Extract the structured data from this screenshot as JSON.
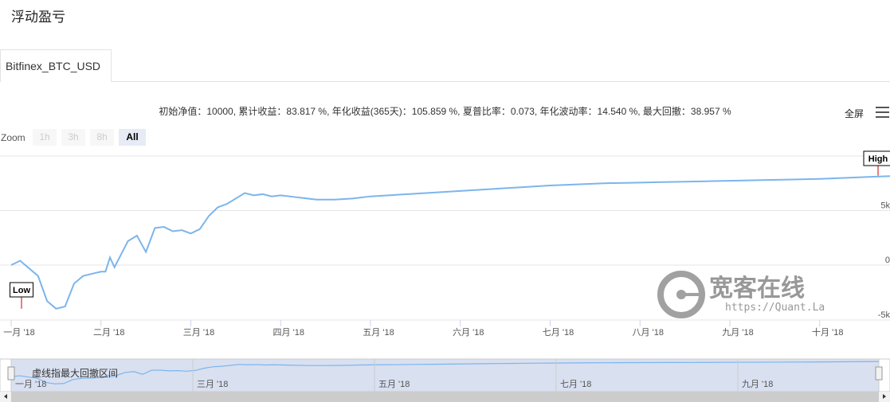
{
  "page": {
    "title": "浮动盈亏",
    "tab": "Bitfinex_BTC_USD",
    "stats": "初始净值：10000, 累计收益：83.817 %, 年化收益(365天)：105.859 %, 夏普比率：0.073, 年化波动率：14.540 %, 最大回撤：38.957 %",
    "fullscreen_label": "全屏",
    "zoom_label": "Zoom",
    "zoom_buttons": [
      "1h",
      "3h",
      "8h",
      "All"
    ],
    "zoom_active": "All",
    "navigator_note": "虚线指最大回撤区间",
    "watermark_name": "宽客在线",
    "watermark_url": "https://Quant.La"
  },
  "chart_data": {
    "type": "line",
    "x_ticks": [
      "一月 '18",
      "二月 '18",
      "三月 '18",
      "四月 '18",
      "五月 '18",
      "六月 '18",
      "七月 '18",
      "八月 '18",
      "九月 '18",
      "十月 '18"
    ],
    "y_ticks": [
      "-5k",
      "0",
      "5k"
    ],
    "y_range": [
      -5000,
      10000
    ],
    "flags": [
      {
        "label": "High",
        "x": 1.0
      },
      {
        "label": "Low",
        "x": 0.145
      }
    ],
    "navigator_ticks": [
      "一月 '18",
      "三月 '18",
      "五月 '18",
      "七月 '18",
      "九月 '18"
    ],
    "series": [
      {
        "color": "#7cb5ec",
        "x": [
          0,
          0.1,
          0.2,
          0.3,
          0.4,
          0.5,
          0.6,
          0.7,
          0.8,
          0.9,
          1.0,
          1.05,
          1.1,
          1.15,
          1.2,
          1.3,
          1.4,
          1.5,
          1.6,
          1.7,
          1.8,
          1.9,
          2.0,
          2.1,
          2.2,
          2.3,
          2.4,
          2.5,
          2.6,
          2.7,
          2.8,
          2.9,
          3.0,
          3.2,
          3.4,
          3.6,
          3.8,
          4.0,
          4.2,
          4.4,
          4.6,
          4.8,
          5.0,
          5.2,
          5.4,
          5.6,
          5.8,
          6.0,
          6.3,
          6.6,
          6.9,
          7.2,
          7.5,
          7.8,
          8.1,
          8.4,
          8.7,
          9.0,
          9.3,
          9.6,
          9.9
        ],
        "values": [
          0,
          400,
          -300,
          -1000,
          -3300,
          -4000,
          -3800,
          -1700,
          -1000,
          -800,
          -600,
          -600,
          700,
          -200,
          600,
          2200,
          2700,
          1200,
          3400,
          3500,
          3100,
          3200,
          2900,
          3300,
          4500,
          5300,
          5600,
          6100,
          6600,
          6400,
          6500,
          6300,
          6400,
          6200,
          6000,
          6000,
          6100,
          6300,
          6400,
          6500,
          6600,
          6700,
          6800,
          6900,
          7000,
          7100,
          7200,
          7300,
          7400,
          7500,
          7550,
          7600,
          7650,
          7700,
          7750,
          7800,
          7850,
          7900,
          8000,
          8100,
          8200
        ]
      }
    ]
  }
}
